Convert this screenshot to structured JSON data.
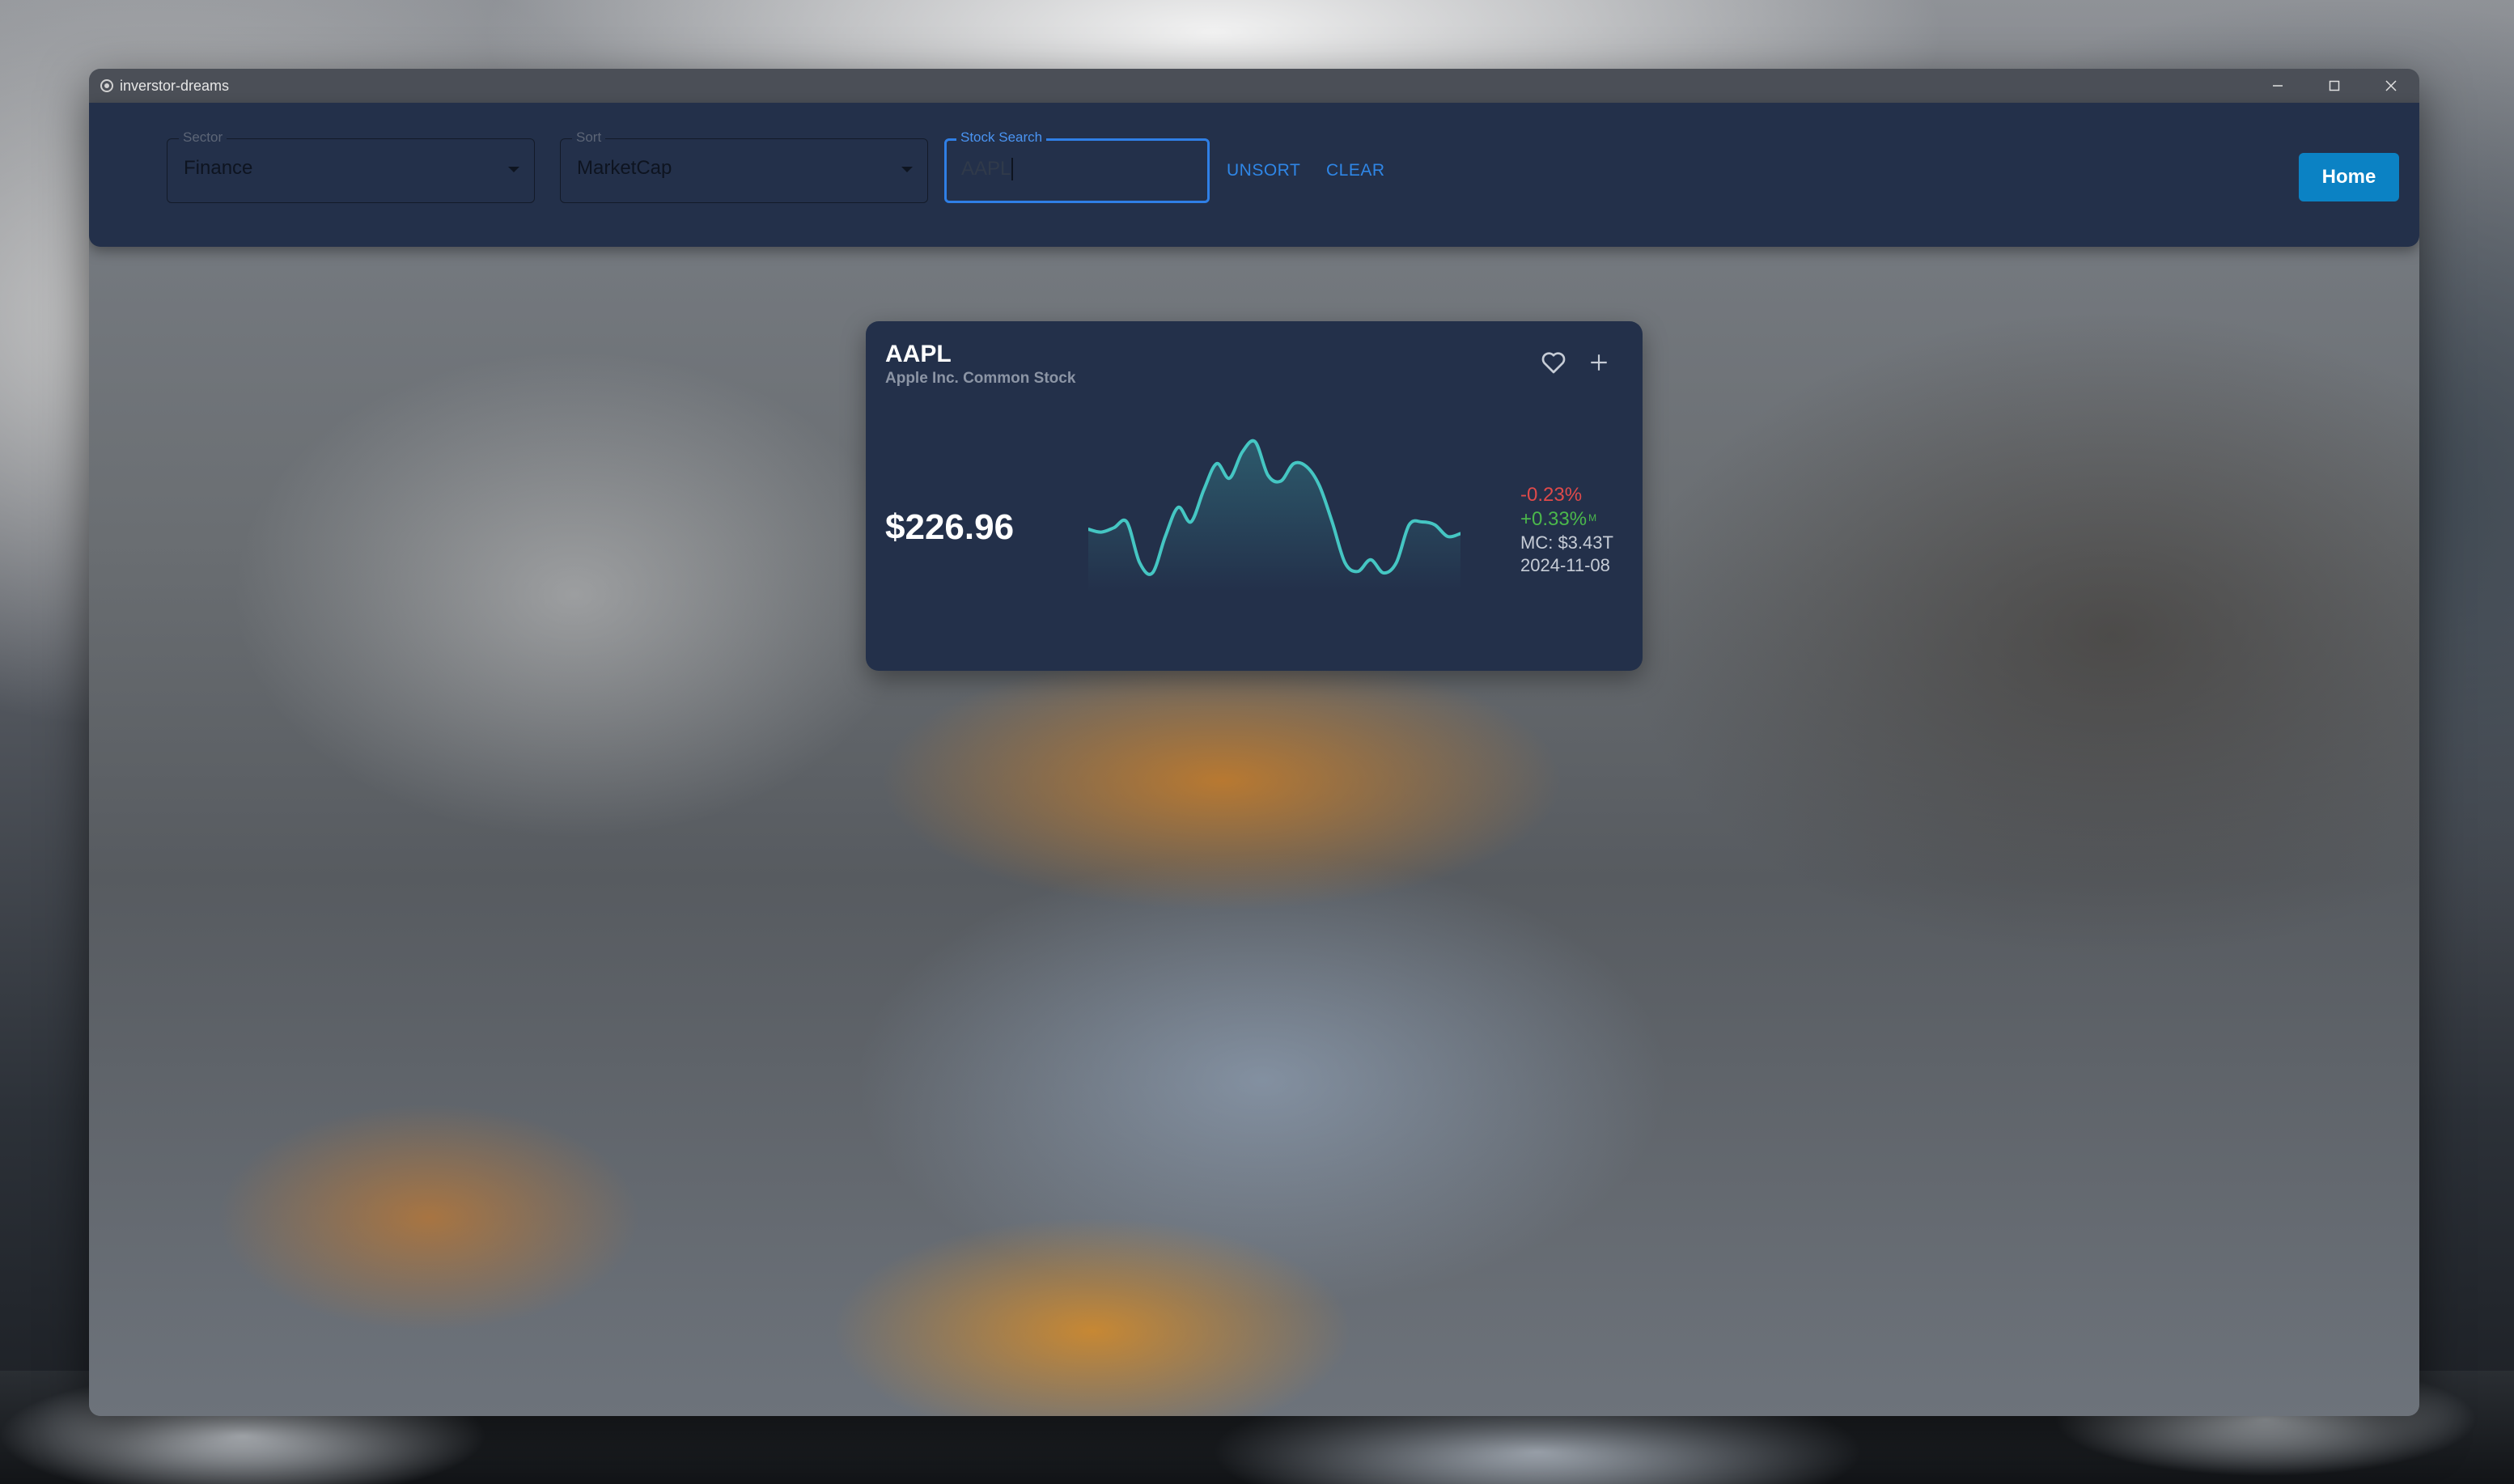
{
  "window": {
    "title": "inverstor-dreams",
    "controls": [
      "minimize",
      "maximize",
      "close"
    ]
  },
  "toolbar": {
    "sector": {
      "label": "Sector",
      "value": "Finance"
    },
    "sort": {
      "label": "Sort",
      "value": "MarketCap"
    },
    "search": {
      "label": "Stock Search",
      "value": "AAPL"
    },
    "unsort_label": "UNSORT",
    "clear_label": "CLEAR",
    "home_label": "Home"
  },
  "card": {
    "ticker": "AAPL",
    "company": "Apple Inc. Common Stock",
    "price": "$226.96",
    "change_day": "-0.23%",
    "change_month": "+0.33%",
    "change_month_marker": "M",
    "market_cap": "MC: $3.43T",
    "date": "2024-11-08",
    "favorite_icon": "heart-icon",
    "add_icon": "plus-icon",
    "colors": {
      "line": "#45c6c3",
      "negative": "#e04a4a",
      "positive": "#4bb84b"
    }
  },
  "chart_data": {
    "type": "line",
    "title": "",
    "xlabel": "",
    "ylabel": "",
    "x": [
      0,
      1,
      2,
      3,
      4,
      5,
      6,
      7,
      8,
      9,
      10,
      11,
      12,
      13,
      14,
      15,
      16,
      17,
      18,
      19,
      20,
      21,
      22,
      23,
      24,
      25,
      26,
      27,
      28,
      29
    ],
    "values": [
      0.35,
      0.33,
      0.36,
      0.4,
      0.12,
      0.05,
      0.3,
      0.5,
      0.4,
      0.62,
      0.8,
      0.7,
      0.88,
      0.95,
      0.72,
      0.68,
      0.8,
      0.78,
      0.65,
      0.4,
      0.12,
      0.06,
      0.14,
      0.05,
      0.12,
      0.38,
      0.4,
      0.38,
      0.3,
      0.32
    ],
    "grid": false,
    "legend": "none"
  }
}
